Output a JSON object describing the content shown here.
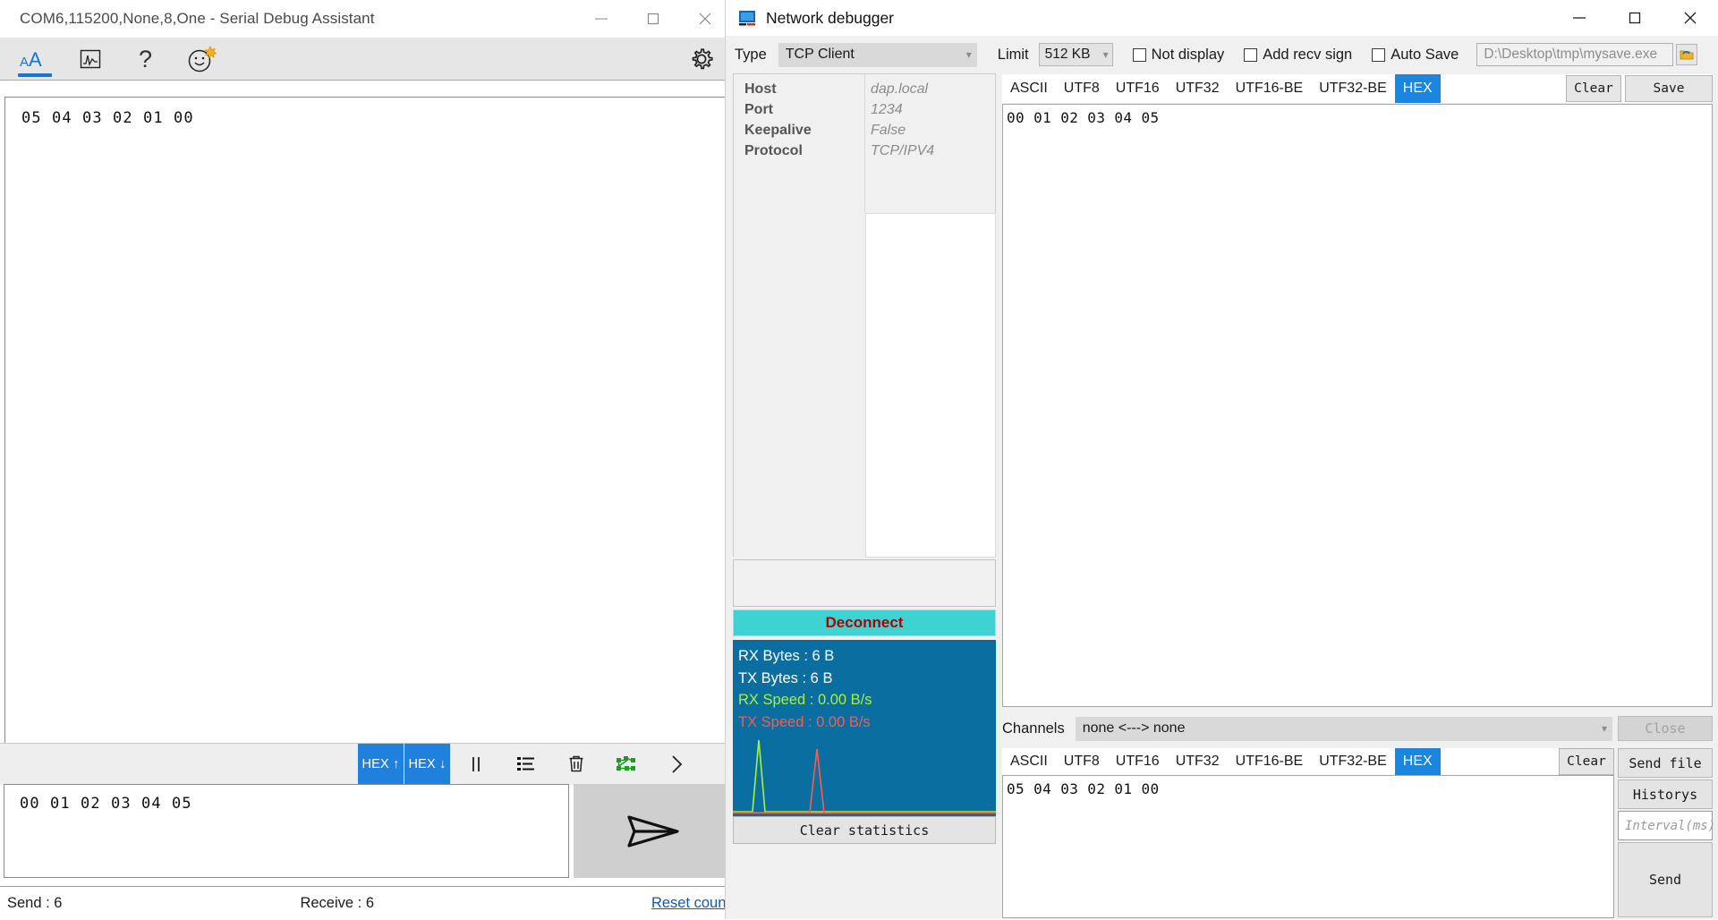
{
  "serial_window": {
    "title": "COM6,115200,None,8,One - Serial Debug Assistant",
    "window_controls": {
      "minimize": "minimize-icon",
      "maximize": "maximize-icon",
      "close": "close-icon"
    },
    "toolbar": {
      "items": [
        {
          "name": "font-size-icon",
          "glyph": "AA",
          "active": true
        },
        {
          "name": "waveform-chart-icon",
          "glyph": "chart",
          "active": false
        },
        {
          "name": "help-icon",
          "glyph": "?",
          "active": false
        },
        {
          "name": "smiley-emoji-icon",
          "glyph": "smiley",
          "active": false
        }
      ],
      "settings": "gear-icon"
    },
    "receive_text": "05 04 03 02 01 00",
    "bottom_strip": {
      "hex_up_label": "HEX ↑",
      "hex_down_label": "HEX ↓",
      "icons": [
        "pause-icon",
        "list-icon",
        "trash-icon",
        "flowchart-icon",
        "chevron-right-icon"
      ]
    },
    "send_text": "00 01 02 03 04 05",
    "send_button_icon": "paper-plane-send-icon",
    "status": {
      "send_label": "Send :  6",
      "receive_label": "Receive :  6",
      "reset_label": "Reset count"
    }
  },
  "network_window": {
    "title": "Network debugger",
    "app_icon": "network-debugger-app-icon",
    "window_controls": {
      "minimize": "minimize-icon",
      "maximize": "maximize-icon",
      "close": "close-icon"
    },
    "top_controls": {
      "type_label": "Type",
      "type_value": "TCP Client",
      "limit_label": "Limit",
      "limit_value": "512 KB",
      "not_display_label": "Not display",
      "not_display_checked": false,
      "add_recv_sign_label": "Add recv sign",
      "add_recv_sign_checked": false,
      "auto_save_label": "Auto Save",
      "auto_save_checked": false,
      "save_path_value": "D:\\Desktop\\tmp\\mysave.exe",
      "browse_icon": "folder-open-icon"
    },
    "connection_info": {
      "rows": [
        {
          "key": "Host",
          "value": "dap.local"
        },
        {
          "key": "Port",
          "value": "1234"
        },
        {
          "key": "Keepalive",
          "value": "False"
        },
        {
          "key": "Protocol",
          "value": "TCP/IPV4"
        }
      ]
    },
    "deconnect_label": "Deconnect",
    "statistics": {
      "rx_bytes": "RX Bytes : 6 B",
      "tx_bytes": "TX Bytes : 6 B",
      "rx_speed": "RX Speed : 0.00 B/s",
      "tx_speed": "TX Speed : 0.00 B/s",
      "clear_label": "Clear statistics",
      "rx_color": "#a6f23c",
      "tx_color": "#ff5a4a",
      "panel_color": "#0a6ea0"
    },
    "receive_panel": {
      "encodings": [
        "ASCII",
        "UTF8",
        "UTF16",
        "UTF32",
        "UTF16-BE",
        "UTF32-BE",
        "HEX"
      ],
      "selected_encoding": "HEX",
      "clear_label": "Clear",
      "save_label": "Save",
      "content": "00 01 02 03 04 05"
    },
    "channels": {
      "label": "Channels",
      "value": "none <---> none",
      "close_label": "Close"
    },
    "send_panel": {
      "encodings": [
        "ASCII",
        "UTF8",
        "UTF16",
        "UTF32",
        "UTF16-BE",
        "UTF32-BE",
        "HEX"
      ],
      "selected_encoding": "HEX",
      "clear_label": "Clear",
      "content": "05 04 03 02 01 00",
      "send_file_label": "Send file",
      "historys_label": "Historys",
      "interval_placeholder": "Interval(ms)",
      "interval_value": "",
      "send_label": "Send"
    }
  },
  "theme": {
    "accent_blue": "#1a86e0",
    "teal": "#3ed2d2",
    "deconnect_text": "#b40000",
    "link_blue": "#1457b8"
  }
}
